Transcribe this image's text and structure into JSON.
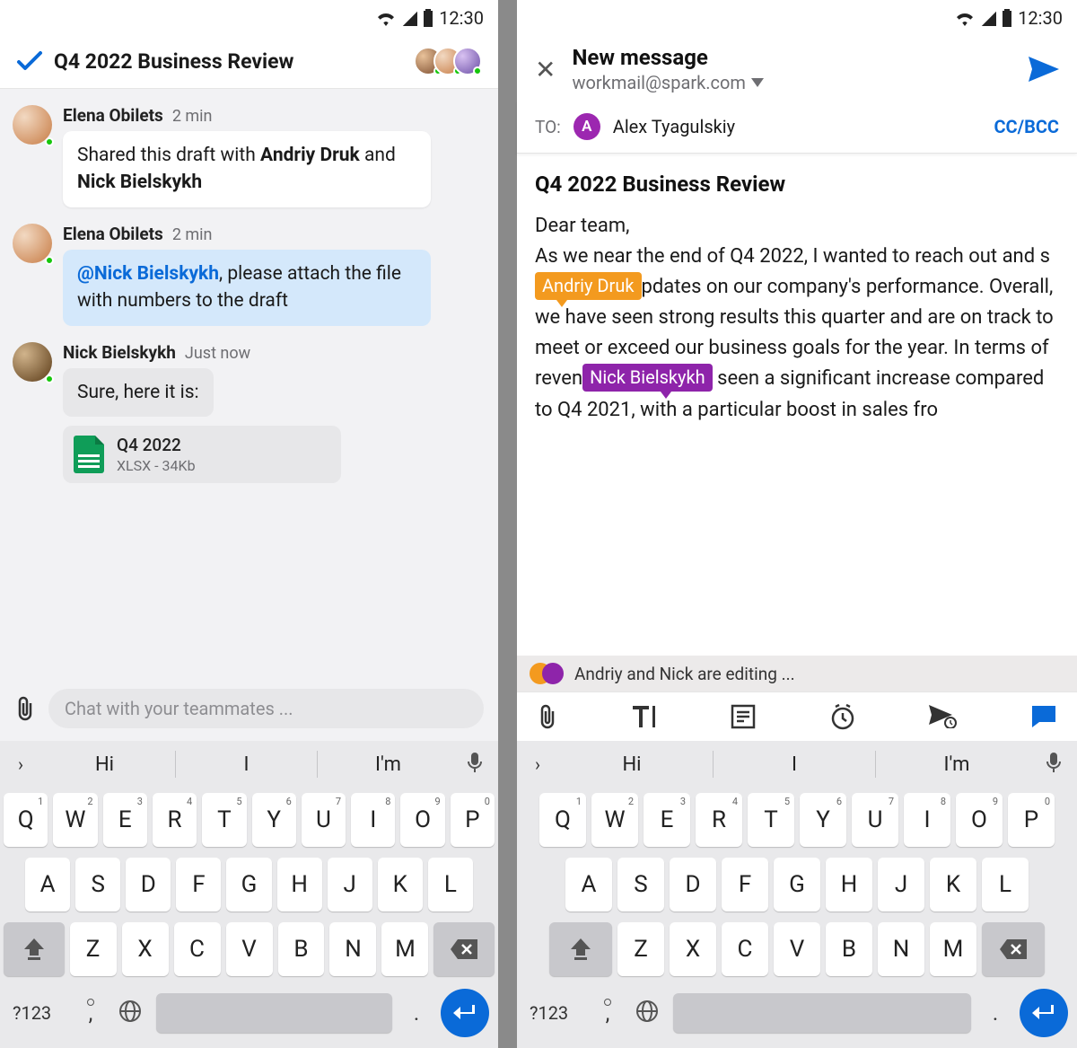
{
  "status": {
    "time": "12:30"
  },
  "left": {
    "title": "Q4 2022 Business Review",
    "messages": [
      {
        "author": "Elena Obilets",
        "time": "2 min",
        "bubble_style": "white",
        "text_pre": "Shared this draft with ",
        "bold1": "Andriy Druk",
        "mid": " and ",
        "bold2": "Nick Bielskykh"
      },
      {
        "author": "Elena Obilets",
        "time": "2 min",
        "bubble_style": "blue",
        "mention": "@Nick Bielskykh",
        "text_post": ", please attach the file with numbers to the draft"
      },
      {
        "author": "Nick Bielskykh",
        "time": "Just now",
        "bubble_style": "grey",
        "text": "Sure, here it is:",
        "attachment": {
          "name": "Q4 2022",
          "meta": "XLSX - 34Kb"
        }
      }
    ],
    "chat_placeholder": "Chat with your teammates ..."
  },
  "right": {
    "title": "New message",
    "from": "workmail@spark.com",
    "to_label": "TO:",
    "to_name": "Alex Tyagulskiy",
    "to_initial": "A",
    "cc": "CC/BCC",
    "subject": "Q4 2022 Business Review",
    "body": "Dear team,\nAs we near the end of Q4 2022, I wanted to reach out and share some updates on our company's performance. Overall, we have seen strong results this quarter and are on track to meet or exceed our business goals for the year. In terms of revenue, we have seen a significant increase compared to Q4 2021, with a particular boost in sales fro",
    "collab": {
      "tag1": "Andriy Druk",
      "tag2": "Nick Bielskykh"
    },
    "editing_text": "Andriy and Nick are editing ..."
  },
  "keyboard": {
    "suggestions": [
      "Hi",
      "I",
      "I'm"
    ],
    "row1": [
      "Q",
      "W",
      "E",
      "R",
      "T",
      "Y",
      "U",
      "I",
      "O",
      "P"
    ],
    "nums": [
      "1",
      "2",
      "3",
      "4",
      "5",
      "6",
      "7",
      "8",
      "9",
      "0"
    ],
    "row2": [
      "A",
      "S",
      "D",
      "F",
      "G",
      "H",
      "J",
      "K",
      "L"
    ],
    "row3": [
      "Z",
      "X",
      "C",
      "V",
      "B",
      "N",
      "M"
    ],
    "numtoggle": "?123",
    "dot": "."
  }
}
